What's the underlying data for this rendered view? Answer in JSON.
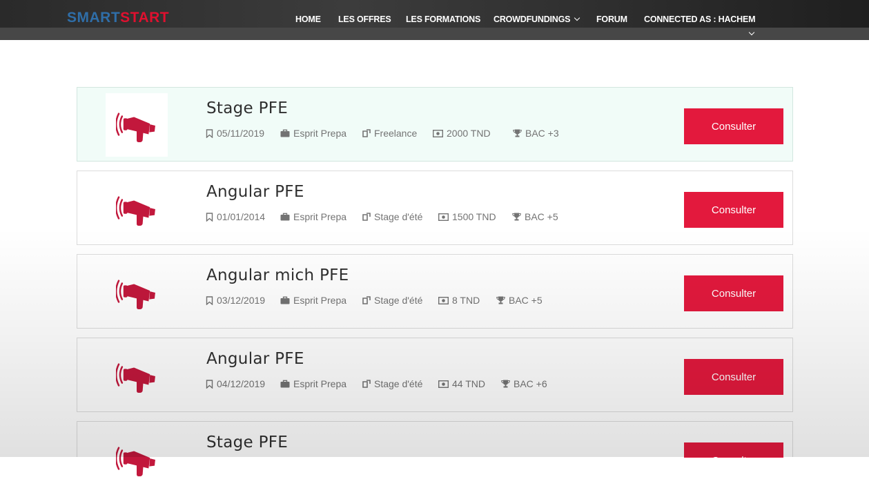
{
  "brand": {
    "part1": "SMART",
    "part2": "START"
  },
  "nav": {
    "home": "HOME",
    "offres": "LES OFFRES",
    "formations": "LES FORMATIONS",
    "crowdfundings": "CROWDFUNDINGS",
    "forum": "FORUM",
    "connected": "CONNECTED AS : HACHEM"
  },
  "colors": {
    "accent": "#e3193d",
    "brand_blue": "#2f6ea8",
    "highlight_row": "#f1fcf8"
  },
  "offers": [
    {
      "title": "Stage PFE",
      "date": "05/11/2019",
      "company": "Esprit Prepa",
      "type": "Freelance",
      "salary": "2000 TND",
      "level": "BAC +3",
      "button": "Consulter"
    },
    {
      "title": "Angular PFE",
      "date": "01/01/2014",
      "company": "Esprit Prepa",
      "type": "Stage d'été",
      "salary": "1500 TND",
      "level": "BAC +5",
      "button": "Consulter"
    },
    {
      "title": "Angular mich PFE",
      "date": "03/12/2019",
      "company": "Esprit Prepa",
      "type": "Stage d'été",
      "salary": "8 TND",
      "level": "BAC +5",
      "button": "Consulter"
    },
    {
      "title": "Angular PFE",
      "date": "04/12/2019",
      "company": "Esprit Prepa",
      "type": "Stage d'été",
      "salary": "44 TND",
      "level": "BAC +6",
      "button": "Consulter"
    },
    {
      "title": "Stage PFE",
      "button": "Consulter"
    }
  ]
}
